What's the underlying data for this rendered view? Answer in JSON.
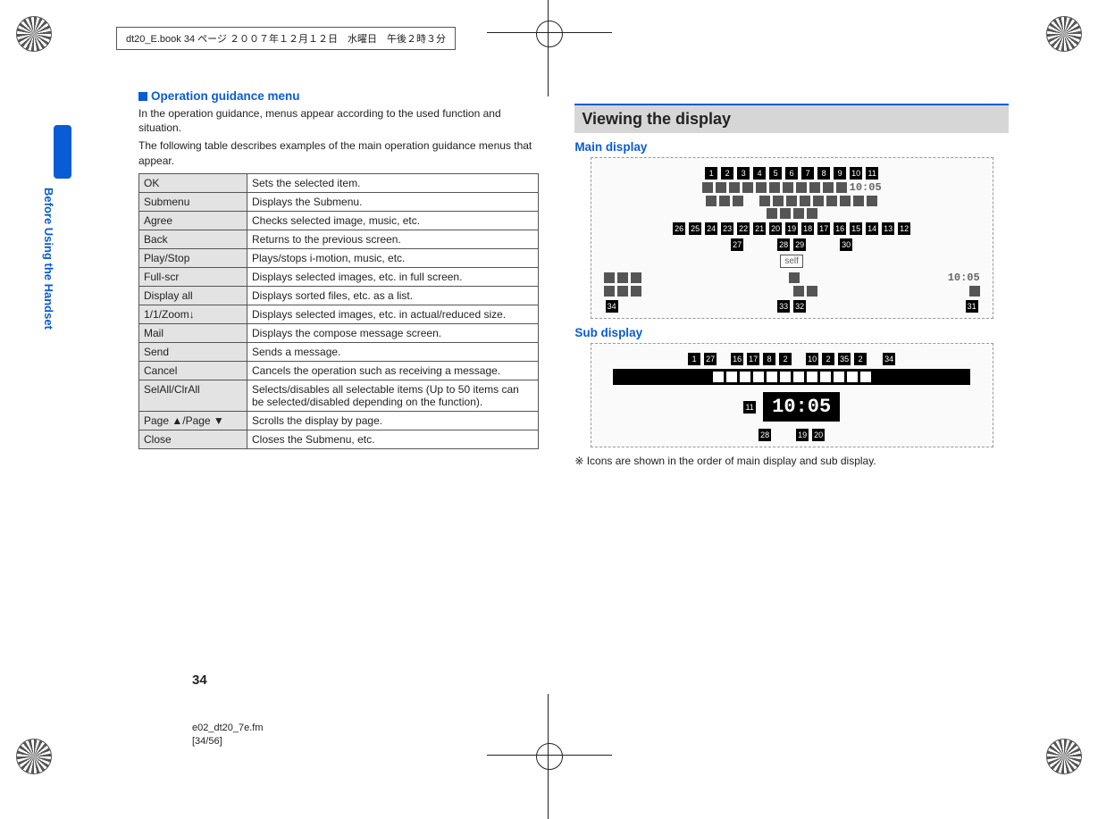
{
  "header_box": "dt20_E.book  34 ページ  ２００７年１２月１２日　水曜日　午後２時３分",
  "spine_label": "Before Using the Handset",
  "section1_title": "Operation guidance menu",
  "para1": "In the operation guidance, menus appear according to the used function and situation.",
  "para2": "The following table describes examples of the main operation guidance menus that appear.",
  "menu_table": [
    {
      "label": "OK",
      "desc": "Sets the selected item."
    },
    {
      "label": "Submenu",
      "desc": "Displays the Submenu."
    },
    {
      "label": "Agree",
      "desc": "Checks selected image, music, etc."
    },
    {
      "label": "Back",
      "desc": "Returns to the previous screen."
    },
    {
      "label": "Play/Stop",
      "desc": "Plays/stops i-motion, music, etc."
    },
    {
      "label": "Full-scr",
      "desc": "Displays selected images, etc. in full screen."
    },
    {
      "label": "Display all",
      "desc": "Displays sorted files, etc. as a list."
    },
    {
      "label": "1/1/Zoom↓",
      "desc": "Displays selected images, etc. in actual/reduced size."
    },
    {
      "label": "Mail",
      "desc": "Displays the compose message screen."
    },
    {
      "label": "Send",
      "desc": "Sends a message."
    },
    {
      "label": "Cancel",
      "desc": "Cancels the operation such as receiving a message."
    },
    {
      "label": "SelAll/ClrAll",
      "desc": "Selects/disables all selectable items (Up to 50 items can be selected/disabled depending on the function)."
    },
    {
      "label": "Page ▲/Page ▼",
      "desc": "Scrolls the display by page."
    },
    {
      "label": "Close",
      "desc": "Closes the Submenu, etc."
    }
  ],
  "viewing_title": "Viewing the display",
  "main_display_label": "Main display",
  "sub_display_label": "Sub display",
  "clock_time": "10:05",
  "callout_numbers_row1": [
    "1",
    "2",
    "3",
    "4",
    "5",
    "6",
    "7",
    "8",
    "9",
    "10",
    "11"
  ],
  "callout_numbers_row2": [
    "26",
    "25",
    "24",
    "23",
    "22",
    "21",
    "20",
    "19",
    "18",
    "17",
    "16",
    "15",
    "14",
    "13",
    "12"
  ],
  "callout_numbers_row3": [
    "27",
    "28",
    "29",
    "30"
  ],
  "callout_numbers_row4": [
    "34",
    "33",
    "32",
    "31"
  ],
  "sub_callouts_top": [
    "1",
    "27",
    "16",
    "17",
    "8",
    "2",
    "10",
    "2",
    "35",
    "2",
    "34"
  ],
  "sub_callouts_left": [
    "11"
  ],
  "sub_callouts_bottom": [
    "28",
    "19",
    "20"
  ],
  "footnote": "※ Icons are shown in the order of main display and sub display.",
  "page_number": "34",
  "footer_file_1": "e02_dt20_7e.fm",
  "footer_file_2": "[34/56]",
  "self_label": "self"
}
